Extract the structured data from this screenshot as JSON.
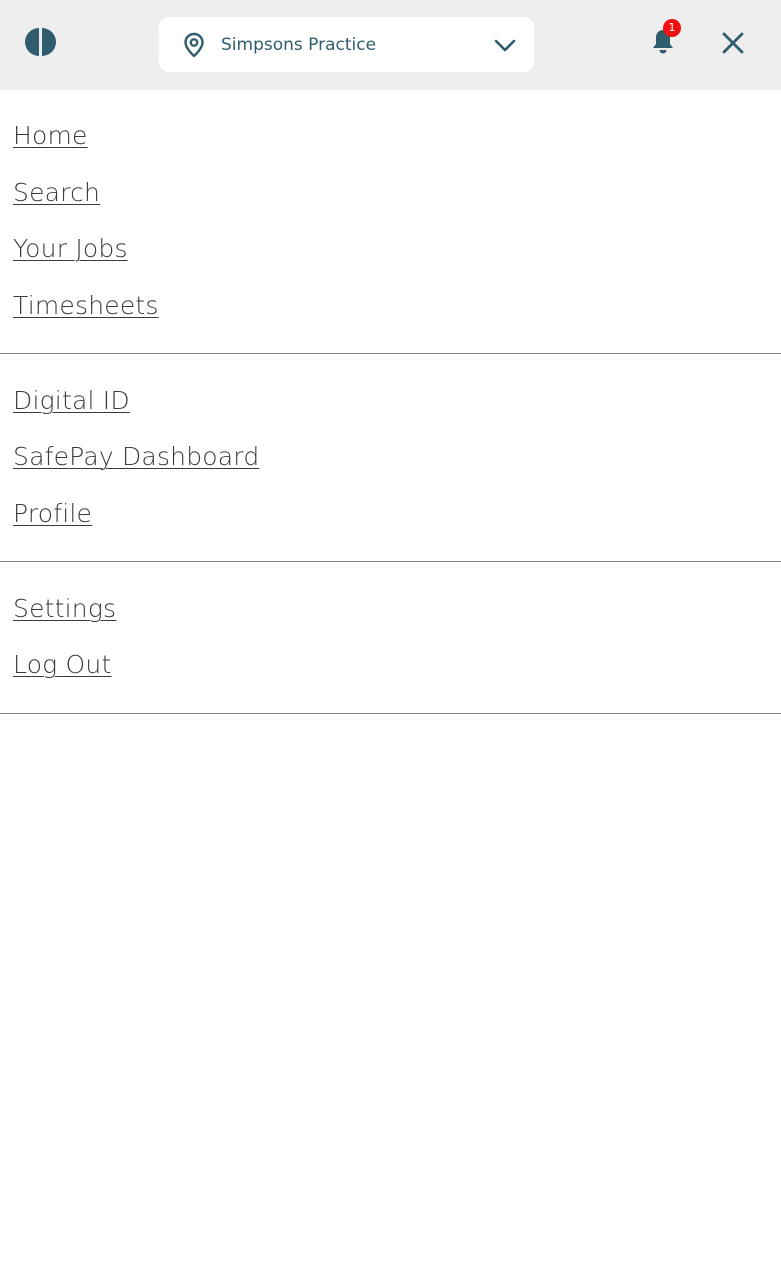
{
  "header": {
    "logo_icon": "half-circle-logo-icon",
    "location": {
      "icon": "map-pin-icon",
      "selected": "Simpsons Practice",
      "dropdown_icon": "chevron-down-icon"
    },
    "notifications": {
      "icon": "bell-icon",
      "count": "1"
    },
    "close_icon": "close-icon"
  },
  "nav": {
    "primary": [
      {
        "label": "Home"
      },
      {
        "label": "Search"
      },
      {
        "label": "Your Jobs"
      },
      {
        "label": "Timesheets"
      }
    ],
    "secondary": [
      {
        "label": "Digital ID"
      },
      {
        "label": "SafePay Dashboard"
      },
      {
        "label": "Profile"
      }
    ],
    "account": [
      {
        "label": "Settings"
      },
      {
        "label": "Log Out"
      }
    ]
  },
  "colors": {
    "header_bg": "#eeeeee",
    "brand": "#2f5d6e",
    "badge": "#f01010",
    "link_text": "#3a3a3a",
    "divider": "#8a8a8a"
  }
}
